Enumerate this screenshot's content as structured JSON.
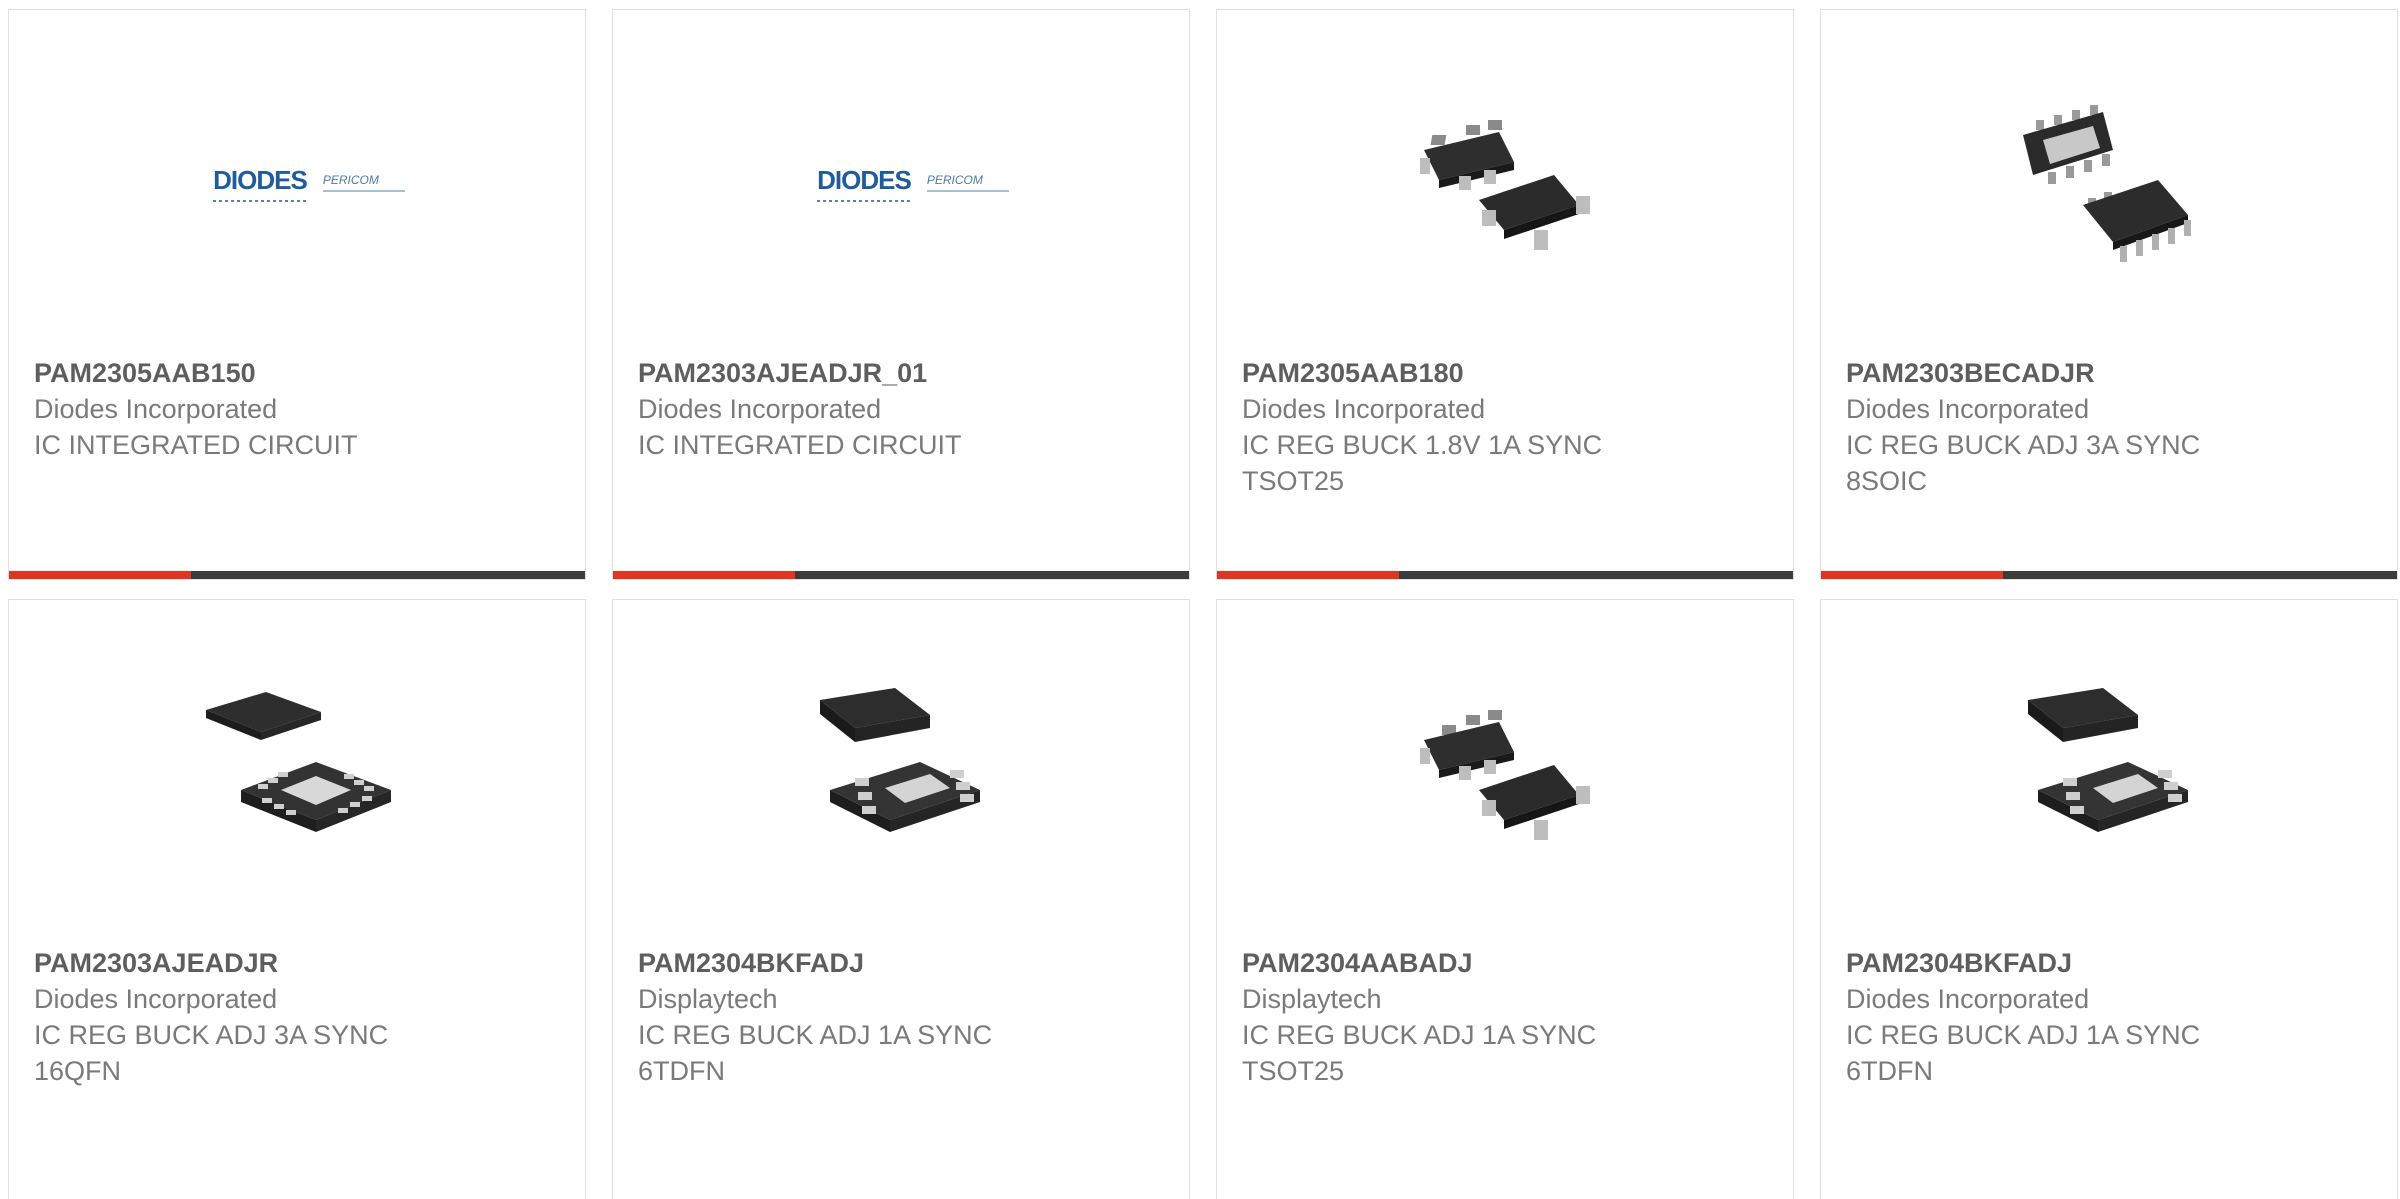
{
  "theme": {
    "accent": "#e0361f",
    "bar": "#3c3c3c"
  },
  "products": [
    {
      "part": "PAM2305AAB150",
      "manufacturer": "Diodes Incorporated",
      "desc1": "IC INTEGRATED CIRCUIT",
      "desc2": "",
      "image": "diodes-pericom-logo"
    },
    {
      "part": "PAM2303AJEADJR_01",
      "manufacturer": "Diodes Incorporated",
      "desc1": "IC INTEGRATED CIRCUIT",
      "desc2": "",
      "image": "diodes-pericom-logo"
    },
    {
      "part": "PAM2305AAB180",
      "manufacturer": "Diodes Incorporated",
      "desc1": "IC REG BUCK 1.8V 1A SYNC",
      "desc2": "TSOT25",
      "image": "tsot25-package-icon"
    },
    {
      "part": "PAM2303BECADJR",
      "manufacturer": "Diodes Incorporated",
      "desc1": "IC REG BUCK ADJ 3A SYNC",
      "desc2": "8SOIC",
      "image": "soic8-package-icon"
    },
    {
      "part": "PAM2303AJEADJR",
      "manufacturer": "Diodes Incorporated",
      "desc1": "IC REG BUCK ADJ 3A SYNC",
      "desc2": "16QFN",
      "image": "qfn16-package-icon"
    },
    {
      "part": "PAM2304BKFADJ",
      "manufacturer": "Displaytech",
      "desc1": "IC REG BUCK ADJ 1A SYNC",
      "desc2": "6TDFN",
      "image": "tdfn6-package-icon"
    },
    {
      "part": "PAM2304AABADJ",
      "manufacturer": "Displaytech",
      "desc1": "IC REG BUCK ADJ 1A SYNC",
      "desc2": "TSOT25",
      "image": "tsot25-package-icon"
    },
    {
      "part": "PAM2304BKFADJ",
      "manufacturer": "Diodes Incorporated",
      "desc1": "IC REG BUCK ADJ 1A SYNC",
      "desc2": "6TDFN",
      "image": "tdfn6-package-icon"
    }
  ],
  "logo": {
    "brand1": "DIODES",
    "brand2": "PERICOM"
  }
}
